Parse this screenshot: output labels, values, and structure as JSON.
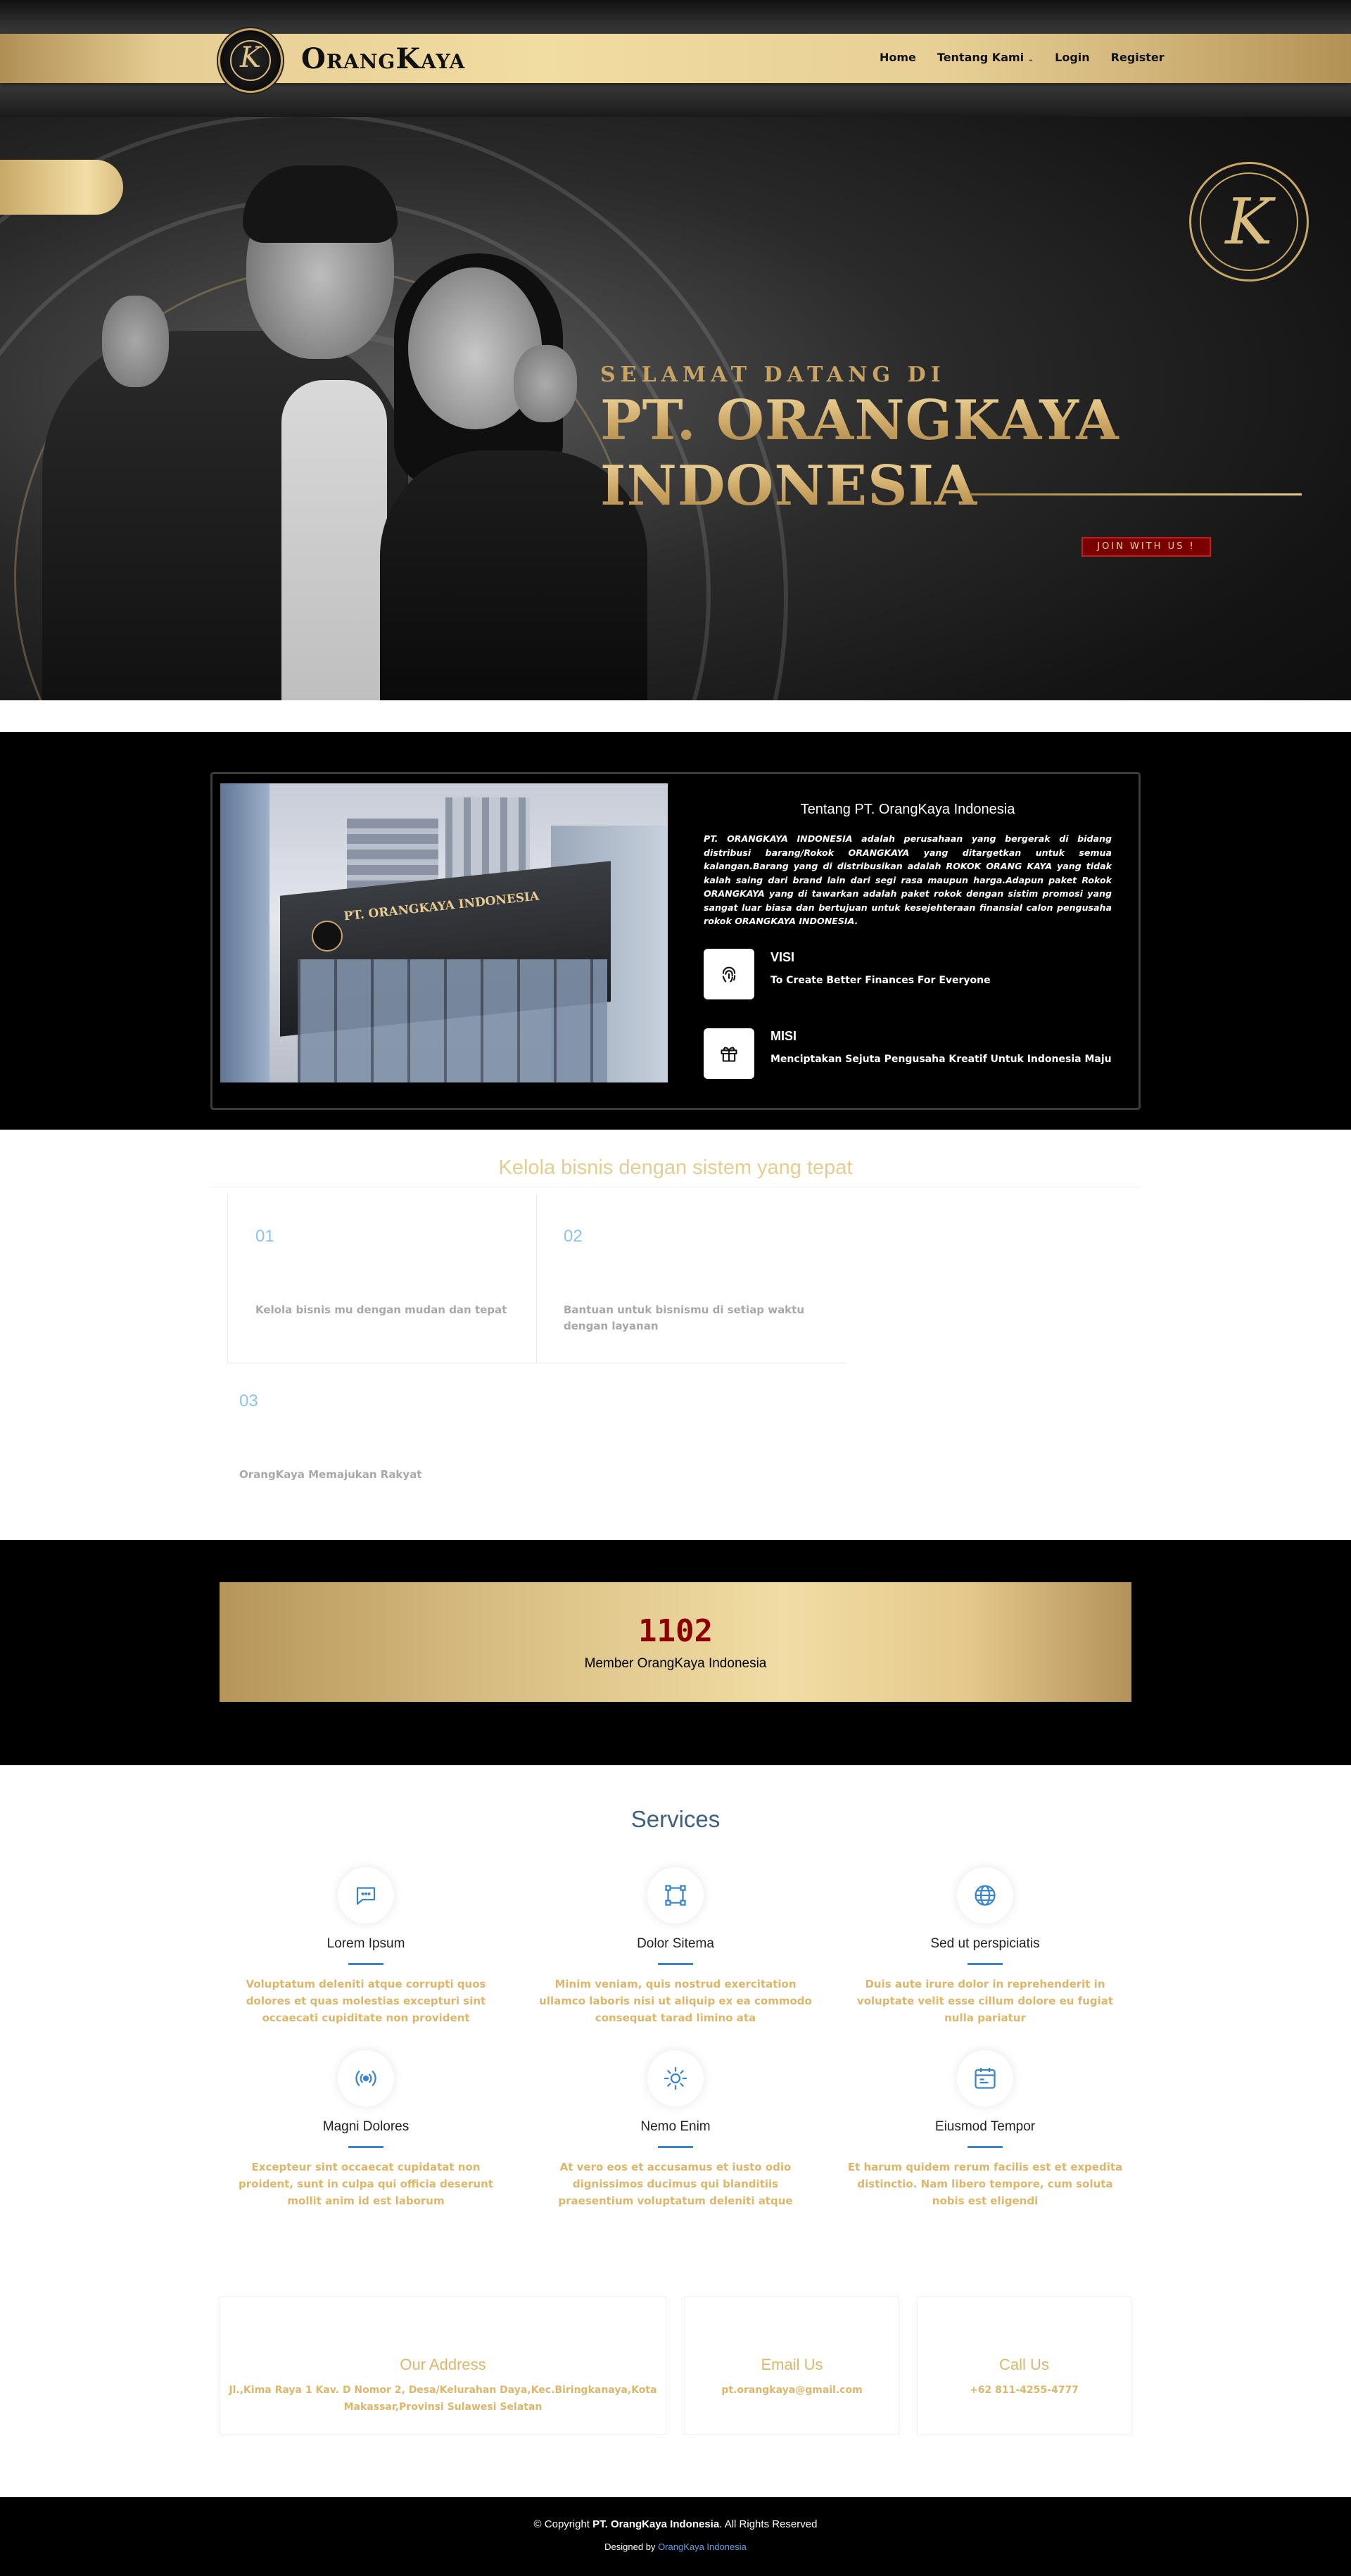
{
  "nav": {
    "brand": "OrangKaya",
    "logo_letter": "K",
    "links": [
      "Home",
      "Tentang Kami",
      "Login",
      "Register"
    ]
  },
  "hero": {
    "welcome": "SELAMAT DATANG DI",
    "title_line1": "PT. ORANGKAYA",
    "title_line2": "INDONESIA",
    "join_button": "JOIN WITH US !"
  },
  "about": {
    "image_sign": "PT. ORANGKAYA INDONESIA",
    "title": "Tentang PT. OrangKaya Indonesia",
    "text": "PT. ORANGKAYA INDONESIA adalah perusahaan yang bergerak di bidang distribusi barang/Rokok ORANGKAYA yang ditargetkan untuk semua kalangan.Barang yang di distribusikan adalah ROKOK ORANG KAYA yang tidak kalah saing dari brand lain dari segi rasa maupun harga.Adapun paket Rokok ORANGKAYA yang di tawarkan adalah paket rokok dengan sistim promosi yang sangat luar biasa dan bertujuan untuk kesejehteraan finansial calon pengusaha rokok ORANGKAYA INDONESIA.",
    "visi_label": "VISI",
    "visi_text": "To Create Better Finances For Everyone",
    "misi_label": "MISI",
    "misi_text": "Menciptakan Sejuta Pengusaha Kreatif Untuk Indonesia Maju"
  },
  "kelola": {
    "title": "Kelola bisnis dengan sistem yang tepat",
    "steps": [
      {
        "num": "01",
        "text": "Kelola bisnis mu dengan mudan dan tepat"
      },
      {
        "num": "02",
        "text": "Bantuan untuk bisnismu di setiap waktu dengan layanan"
      },
      {
        "num": "03",
        "text": "OrangKaya Memajukan Rakyat"
      }
    ]
  },
  "counter": {
    "value": "1102",
    "label": "Member OrangKaya Indonesia"
  },
  "services": {
    "title": "Services",
    "items": [
      {
        "title": "Lorem Ipsum",
        "desc": "Voluptatum deleniti atque corrupti quos dolores et quas molestias excepturi sint occaecati cupiditate non provident",
        "icon": "chat-icon"
      },
      {
        "title": "Dolor Sitema",
        "desc": "Minim veniam, quis nostrud exercitation ullamco laboris nisi ut aliquip ex ea commodo consequat tarad limino ata",
        "icon": "bounding-box-icon"
      },
      {
        "title": "Sed ut perspiciatis",
        "desc": "Duis aute irure dolor in reprehenderit in voluptate velit esse cillum dolore eu fugiat nulla pariatur",
        "icon": "globe-icon"
      },
      {
        "title": "Magni Dolores",
        "desc": "Excepteur sint occaecat cupidatat non proident, sunt in culpa qui officia deserunt mollit anim id est laborum",
        "icon": "broadcast-icon"
      },
      {
        "title": "Nemo Enim",
        "desc": "At vero eos et accusamus et iusto odio dignissimos ducimus qui blanditiis praesentium voluptatum deleniti atque",
        "icon": "sun-icon"
      },
      {
        "title": "Eiusmod Tempor",
        "desc": "Et harum quidem rerum facilis est et expedita distinctio. Nam libero tempore, cum soluta nobis est eligendi",
        "icon": "calendar-icon"
      }
    ]
  },
  "contact": {
    "address_title": "Our Address",
    "address": "Jl.,Kima Raya 1 Kav. D Nomor 2, Desa/Kelurahan Daya,Kec.Biringkanaya,Kota Makassar,Provinsi Sulawesi Selatan",
    "email_title": "Email Us",
    "email": "pt.orangkaya@gmail.com",
    "call_title": "Call Us",
    "phone": "+62 811-4255-4777"
  },
  "footer": {
    "copy_prefix": "© Copyright",
    "company": "PT. OrangKaya Indonesia",
    "copy_suffix": ". All Rights Reserved",
    "designed_by": "Designed by",
    "designer": "OrangKaya Indonesia"
  },
  "colors": {
    "gold": "#dcb76b",
    "dark": "#000000",
    "counter_red": "#8c0000",
    "service_blue": "#3a84c8"
  }
}
